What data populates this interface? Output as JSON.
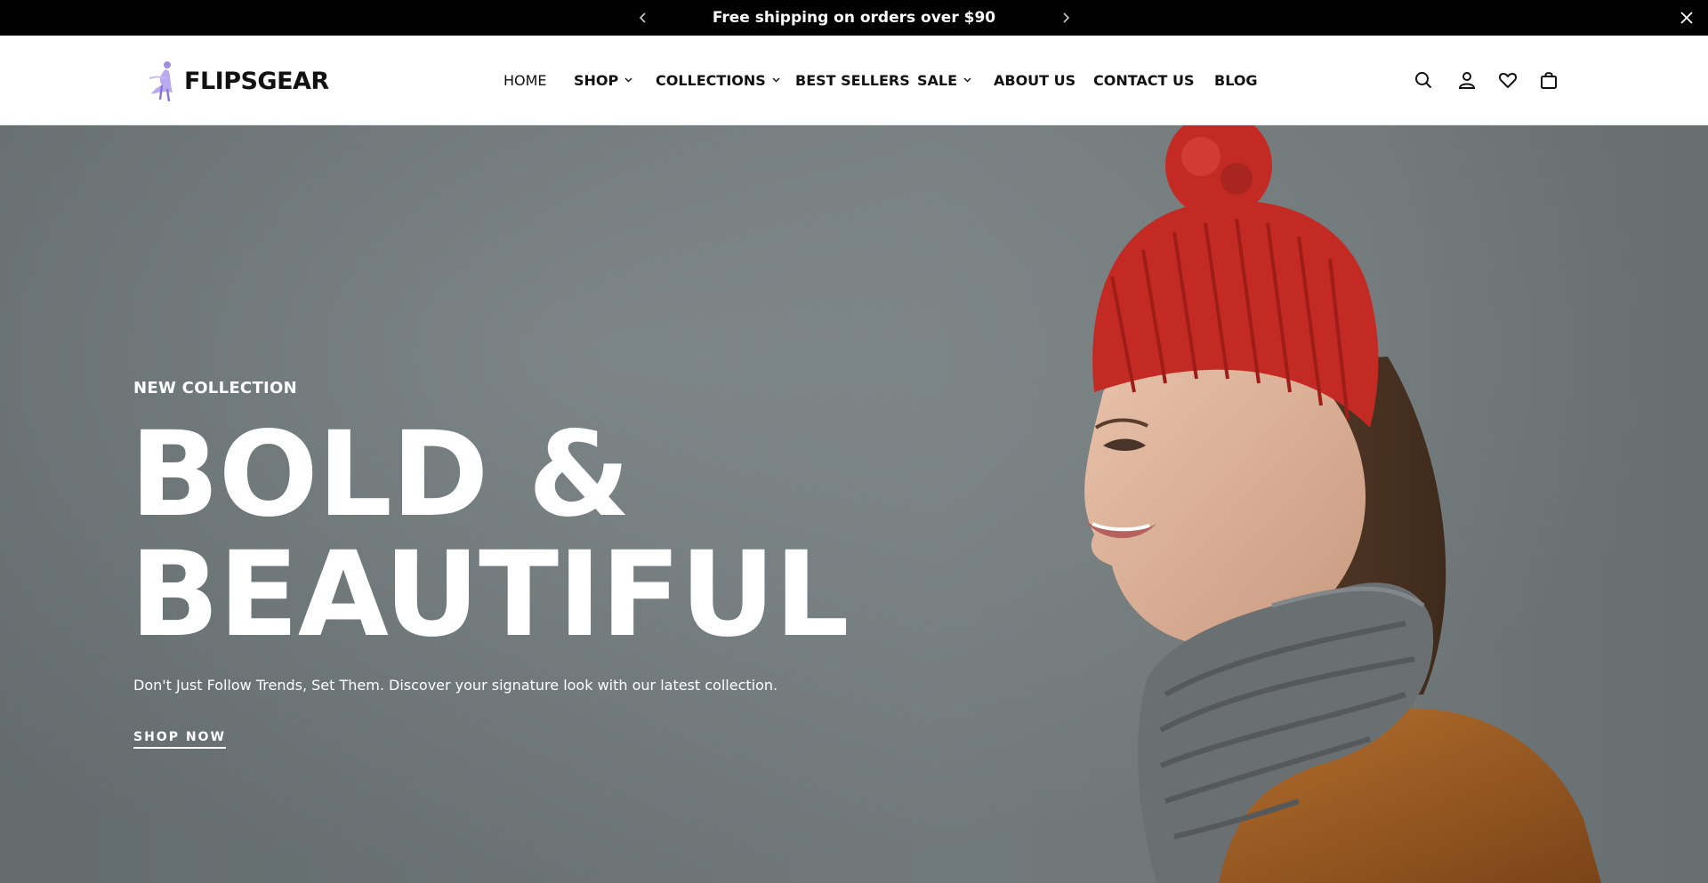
{
  "announcement": {
    "text": "Free shipping on orders over $90",
    "prev_icon": "chevron-left-icon",
    "next_icon": "chevron-right-icon",
    "close_icon": "close-icon"
  },
  "brand": {
    "name": "FLIPSGEAR",
    "logo_accent": "#a08fe0"
  },
  "nav": {
    "home": "HOME",
    "shop": "SHOP",
    "collections": "COLLECTIONS",
    "best_sellers": "BEST SELLERS",
    "sale": "SALE",
    "about": "ABOUT US",
    "contact": "CONTACT US",
    "blog": "BLOG"
  },
  "header_icons": [
    "search-icon",
    "account-icon",
    "wishlist-icon",
    "cart-icon"
  ],
  "hero": {
    "eyebrow": "NEW COLLECTION",
    "headline_line1": "BOLD &",
    "headline_line2": "BEAUTIFUL",
    "subcopy": "Don't Just Follow Trends, Set Them. Discover your signature look with our latest collection.",
    "cta": "SHOP NOW"
  },
  "colors": {
    "announcement_bg": "#000000",
    "header_bg": "#ffffff",
    "hero_bg": "#737c7e",
    "hat": "#c42a24",
    "scarf": "#6a6f72",
    "jacket": "#a4612a"
  }
}
